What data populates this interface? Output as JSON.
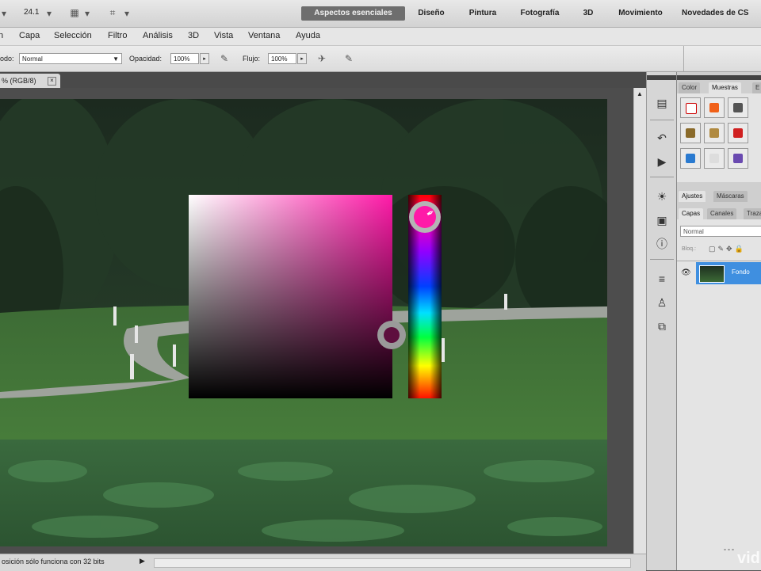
{
  "appbar": {
    "zoom_value": "24.1",
    "workspaces": [
      "Aspectos esenciales",
      "Diseño",
      "Pintura",
      "Fotografía",
      "3D",
      "Movimiento",
      "Novedades de CS"
    ]
  },
  "menus": [
    "n",
    "Capa",
    "Selección",
    "Filtro",
    "Análisis",
    "3D",
    "Vista",
    "Ventana",
    "Ayuda"
  ],
  "options": {
    "mode_label": "odo:",
    "mode_value": "Normal",
    "opacity_label": "Opacidad:",
    "opacity_value": "100%",
    "flow_label": "Flujo:",
    "flow_value": "100%"
  },
  "document": {
    "tab_label": "% (RGB/8)",
    "status_text": "osición sólo funciona con 32 bits"
  },
  "panels": {
    "top_tabs": [
      "Color",
      "Muestras",
      "E"
    ],
    "mid_tabs": [
      "Ajustes",
      "Máscaras"
    ],
    "layer_tabs": [
      "Capas",
      "Canales",
      "Trazados"
    ],
    "blend_mode": "Normal",
    "lock_label": "Bloq.:",
    "layer_name": "Fondo"
  },
  "color_picker": {
    "hue": "magenta",
    "selected_color": "#5e0f3e",
    "hue_color": "#ff1aa8"
  },
  "watermark": "vid",
  "icons": [
    "arrange-icon",
    "brush-icon",
    "eyedropper-icon",
    "history-icon",
    "actions-icon",
    "adjust-icon",
    "image-icon",
    "info-icon",
    "layers-icon",
    "clone-icon",
    "paths-icon"
  ]
}
